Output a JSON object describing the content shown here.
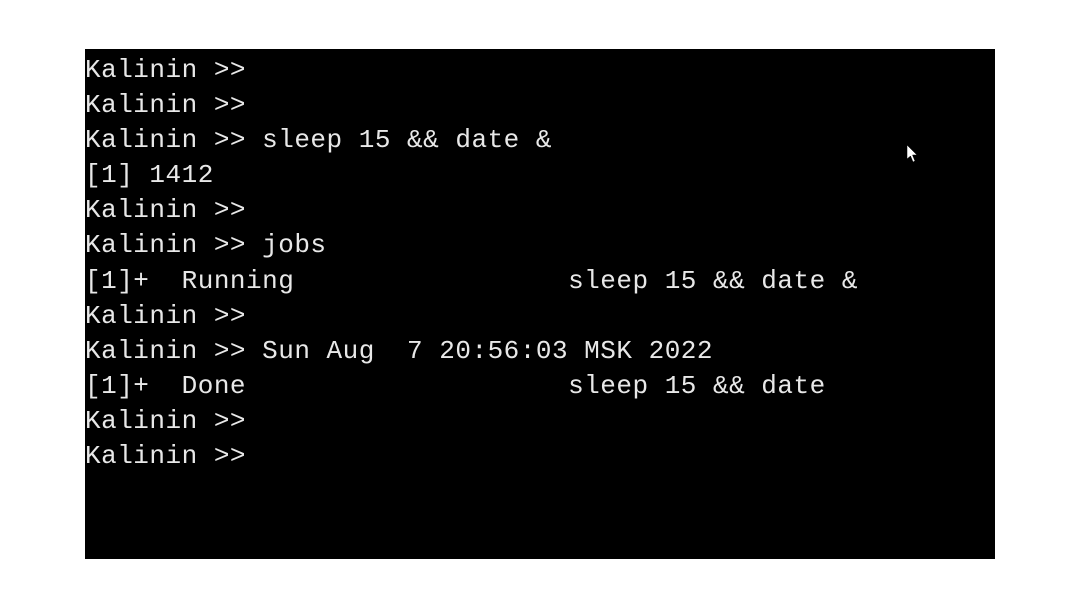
{
  "terminal": {
    "lines": [
      "Kalinin >>",
      "Kalinin >>",
      "Kalinin >> sleep 15 && date &",
      "[1] 1412",
      "Kalinin >>",
      "Kalinin >> jobs",
      "[1]+  Running                 sleep 15 && date &",
      "Kalinin >>",
      "Kalinin >> Sun Aug  7 20:56:03 MSK 2022",
      "",
      "[1]+  Done                    sleep 15 && date",
      "Kalinin >>",
      "Kalinin >>"
    ]
  }
}
